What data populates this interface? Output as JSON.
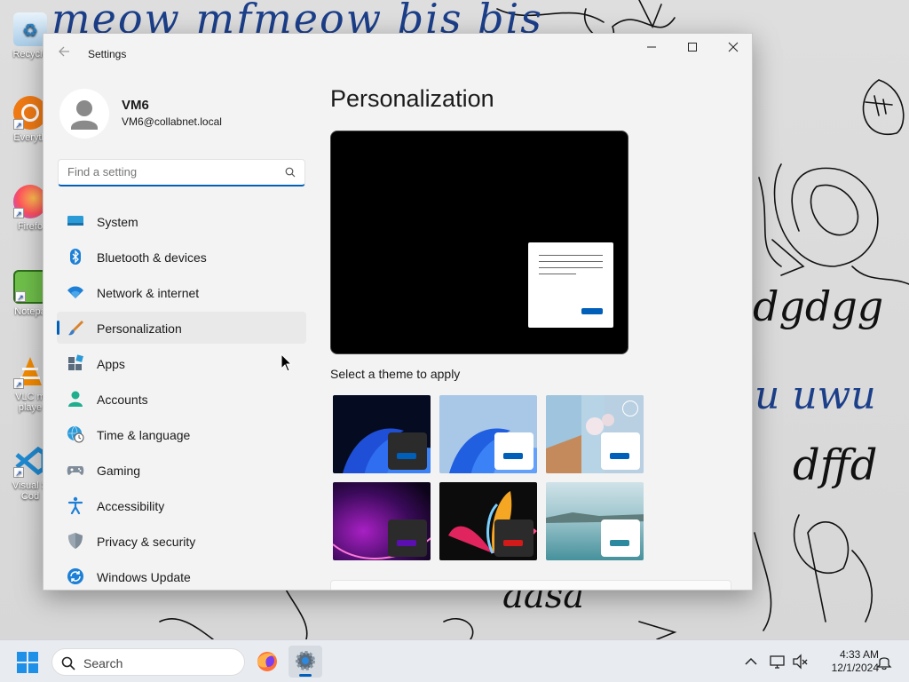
{
  "desktop": {
    "scribbles": [
      "meow mfmeow bis bis",
      "dgdgg",
      "u uwu",
      "dffd",
      "aasa"
    ],
    "icons": [
      {
        "label": "Recycle",
        "icon": "recycle-bin-icon"
      },
      {
        "label": "Everyth",
        "icon": "everything-icon"
      },
      {
        "label": "Firefo",
        "icon": "firefox-icon"
      },
      {
        "label": "Notepa",
        "icon": "notepad-icon"
      },
      {
        "label": "VLC m\nplaye",
        "icon": "vlc-icon"
      },
      {
        "label": "Visual S\nCod",
        "icon": "vscode-icon"
      }
    ]
  },
  "window": {
    "title": "Settings",
    "controls": {
      "minimize": "minimize-icon",
      "maximize": "maximize-icon",
      "close": "close-icon"
    }
  },
  "profile": {
    "name": "VM6",
    "email": "VM6@collabnet.local"
  },
  "search": {
    "placeholder": "Find a setting"
  },
  "sidebar": {
    "items": [
      {
        "label": "System",
        "icon": "system-icon",
        "selected": false
      },
      {
        "label": "Bluetooth & devices",
        "icon": "bluetooth-icon",
        "selected": false
      },
      {
        "label": "Network & internet",
        "icon": "wifi-icon",
        "selected": false
      },
      {
        "label": "Personalization",
        "icon": "brush-icon",
        "selected": true
      },
      {
        "label": "Apps",
        "icon": "apps-icon",
        "selected": false
      },
      {
        "label": "Accounts",
        "icon": "accounts-icon",
        "selected": false
      },
      {
        "label": "Time & language",
        "icon": "globe-clock-icon",
        "selected": false
      },
      {
        "label": "Gaming",
        "icon": "gamepad-icon",
        "selected": false
      },
      {
        "label": "Accessibility",
        "icon": "accessibility-icon",
        "selected": false
      },
      {
        "label": "Privacy & security",
        "icon": "shield-icon",
        "selected": false
      },
      {
        "label": "Windows Update",
        "icon": "update-icon",
        "selected": false
      }
    ]
  },
  "main": {
    "title": "Personalization",
    "theme_section_label": "Select a theme to apply",
    "themes": [
      {
        "name": "windows-dark",
        "accent": "#005fb8"
      },
      {
        "name": "windows-light",
        "accent": "#005fb8"
      },
      {
        "name": "windows-spotlight",
        "accent": "#005fb8"
      },
      {
        "name": "glow",
        "accent": "#5b0fb0"
      },
      {
        "name": "captured-motion",
        "accent": "#d11a1a"
      },
      {
        "name": "flow",
        "accent": "#2d8a9e"
      }
    ]
  },
  "taskbar": {
    "search_label": "Search",
    "apps": [
      "firefox-icon",
      "settings-icon"
    ],
    "tray": [
      "chevron-up-icon",
      "network-icon",
      "volume-muted-icon",
      "notification-icon"
    ],
    "time": "4:33 AM",
    "date": "12/1/2024"
  },
  "colors": {
    "accent": "#005fb8",
    "window_bg": "#f3f3f3",
    "taskbar_bg": "#e8ecf1"
  }
}
